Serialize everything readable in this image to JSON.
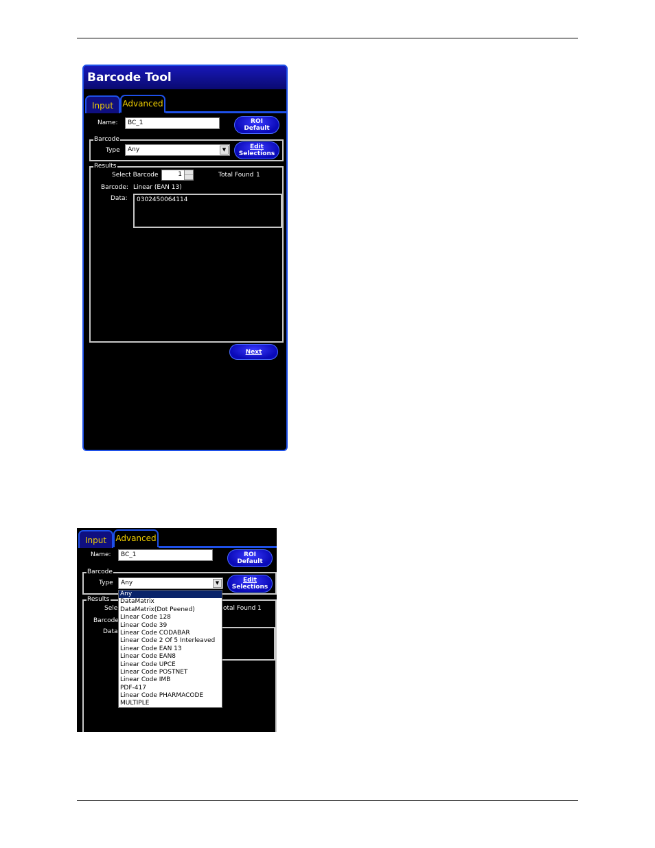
{
  "window1": {
    "title": "Barcode Tool",
    "tabs": [
      {
        "label": "Input",
        "active": true
      },
      {
        "label": "Advanced",
        "active": false
      }
    ],
    "name_label": "Name:",
    "name_value": "BC_1",
    "roi_button": {
      "line1": "ROI",
      "line2": "Default"
    },
    "barcode_group": "Barcode",
    "type_label": "Type",
    "type_value": "Any",
    "edit_button": {
      "line1": "Edit",
      "line2": "Selections"
    },
    "results_group": "Results",
    "select_barcode_label": "Select Barcode",
    "select_barcode_value": "1",
    "total_found_label": "Total Found",
    "total_found_value": "1",
    "barcode_label": "Barcode:",
    "barcode_value": "Linear   (EAN 13)",
    "data_label": "Data:",
    "data_value": "0302450064114",
    "next_button": "Next"
  },
  "window2": {
    "tabs": [
      {
        "label": "Input",
        "active": true
      },
      {
        "label": "Advanced",
        "active": false
      }
    ],
    "name_label": "Name:",
    "name_value": "BC_1",
    "roi_button": {
      "line1": "ROI",
      "line2": "Default"
    },
    "barcode_group": "Barcode",
    "type_label": "Type",
    "type_value": "Any",
    "edit_button": {
      "line1": "Edit",
      "line2": "Selections"
    },
    "results_group": "Results",
    "partial_select": "Sele",
    "partial_total": "otal Found",
    "total_found_value": "1",
    "partial_barcode": "Barcode",
    "partial_data": "Data",
    "dropdown_options": [
      "Any",
      "DataMatrix",
      "DataMatrix(Dot Peened)",
      "Linear Code 128",
      "Linear Code 39",
      "Linear Code CODABAR",
      "Linear Code 2 Of 5 Interleaved",
      "Linear Code EAN 13",
      "Linear Code EAN8",
      "Linear Code UPCE",
      "Linear Code POSTNET",
      "Linear Code IMB",
      "PDF-417",
      "Linear Code PHARMACODE",
      "MULTIPLE"
    ],
    "dropdown_selected": "Any"
  },
  "colors": {
    "panel_bg": "#000000",
    "accent_blue": "#1e50e8",
    "tab_text": "#f2d000",
    "button_blue": "#0a0ab8",
    "selection": "#0a246a"
  }
}
